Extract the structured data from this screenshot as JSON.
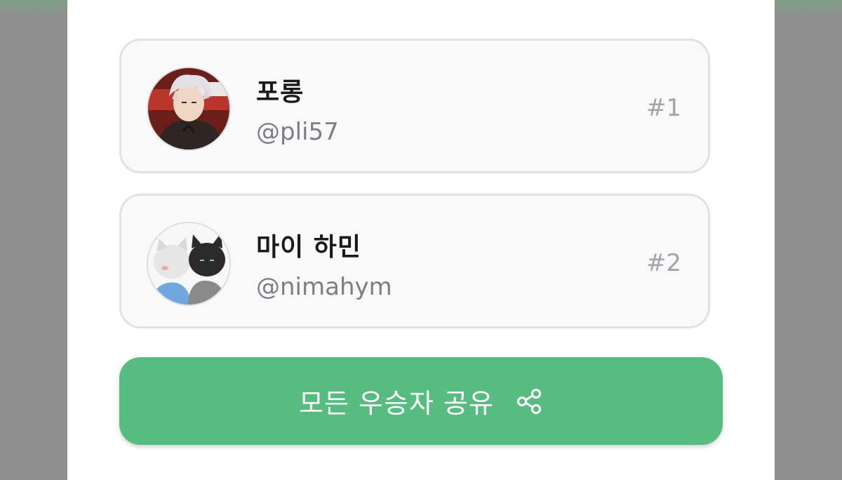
{
  "winners": [
    {
      "name": "포롱",
      "handle": "@pli57",
      "rank": "#1",
      "avatar_icon": "anime-character-avatar"
    },
    {
      "name": "마이 하민",
      "handle": "@nimahym",
      "rank": "#2",
      "avatar_icon": "cats-illustration-avatar"
    }
  ],
  "share_button": {
    "label": "모든 우승자 공유",
    "icon": "share-icon",
    "color": "#57bc80"
  }
}
